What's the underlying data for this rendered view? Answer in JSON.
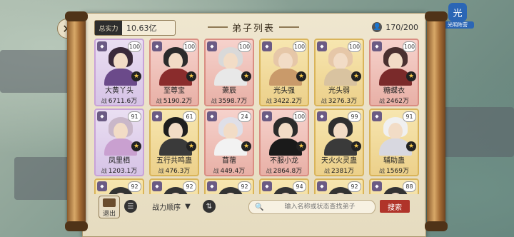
{
  "panel": {
    "title": "弟子列表",
    "power_label": "总实力",
    "power_value": "10.63亿",
    "capacity": "170/200"
  },
  "corner": {
    "icon": "光",
    "label": "光明阵营"
  },
  "disciples": [
    {
      "name": "大黄丫头",
      "level": "100",
      "power": "6711.6万",
      "frame": "purple"
    },
    {
      "name": "至尊宝",
      "level": "100",
      "power": "5190.2万",
      "frame": "red"
    },
    {
      "name": "萧辰",
      "level": "100",
      "power": "3598.7万",
      "frame": "red"
    },
    {
      "name": "光头强",
      "level": "100",
      "power": "3422.2万",
      "frame": "gold"
    },
    {
      "name": "光头弱",
      "level": "100",
      "power": "3276.3万",
      "frame": "gold"
    },
    {
      "name": "糖蝶衣",
      "level": "100",
      "power": "2462万",
      "frame": "red"
    },
    {
      "name": "凤里栖",
      "level": "91",
      "power": "1203.1万",
      "frame": "purple"
    },
    {
      "name": "五行共鸣蛊",
      "level": "61",
      "power": "476.3万",
      "frame": "gold"
    },
    {
      "name": "苜蓿",
      "level": "24",
      "power": "449.4万",
      "frame": "red"
    },
    {
      "name": "不服小龙",
      "level": "100",
      "power": "2864.8万",
      "frame": "red"
    },
    {
      "name": "天火火灵蛊",
      "level": "99",
      "power": "2381万",
      "frame": "gold"
    },
    {
      "name": "辅助蛊",
      "level": "91",
      "power": "1569万",
      "frame": "gold"
    },
    {
      "name": "",
      "level": "92",
      "power": "",
      "frame": "gold"
    },
    {
      "name": "",
      "level": "92",
      "power": "",
      "frame": "gold"
    },
    {
      "name": "",
      "level": "92",
      "power": "",
      "frame": "gold"
    },
    {
      "name": "",
      "level": "94",
      "power": "",
      "frame": "gold"
    },
    {
      "name": "",
      "level": "92",
      "power": "",
      "frame": "gold"
    },
    {
      "name": "",
      "level": "88",
      "power": "",
      "frame": "gold"
    }
  ],
  "power_prefix": "战",
  "bottom": {
    "exit_label": "退出",
    "sort_label": "战力顺序",
    "search_placeholder": "输入名称或状态查找弟子",
    "search_button": "搜索"
  },
  "colors": {
    "accent": "#b0342a",
    "gold": "#d9b45a",
    "paper": "#efe6cf"
  }
}
